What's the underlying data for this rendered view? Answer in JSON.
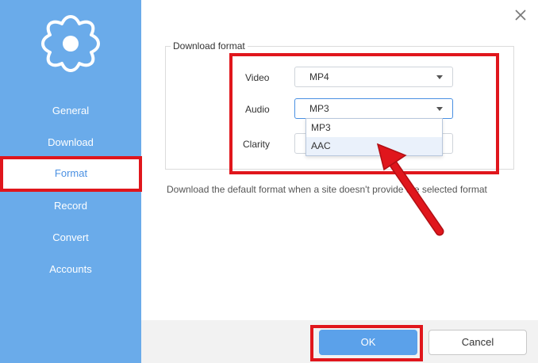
{
  "sidebar": {
    "items": [
      {
        "label": "General"
      },
      {
        "label": "Download"
      },
      {
        "label": "Format"
      },
      {
        "label": "Record"
      },
      {
        "label": "Convert"
      },
      {
        "label": "Accounts"
      }
    ],
    "active": "Format",
    "color": "#6aabea"
  },
  "format": {
    "legend": "Download format",
    "video_label": "Video",
    "video_value": "MP4",
    "audio_label": "Audio",
    "audio_value": "MP3",
    "clarity_label": "Clarity",
    "audio_options": [
      "MP3",
      "AAC"
    ],
    "hovered_option": "AAC"
  },
  "hint": "Download the default format when a site doesn't provide the selected format",
  "buttons": {
    "ok": "OK",
    "cancel": "Cancel"
  },
  "icons": {
    "settings": "gear-icon",
    "close": "close-icon",
    "dropdown": "chevron-down-icon"
  },
  "colors": {
    "accent": "#5ba1ea",
    "annotation": "#e0161c"
  }
}
